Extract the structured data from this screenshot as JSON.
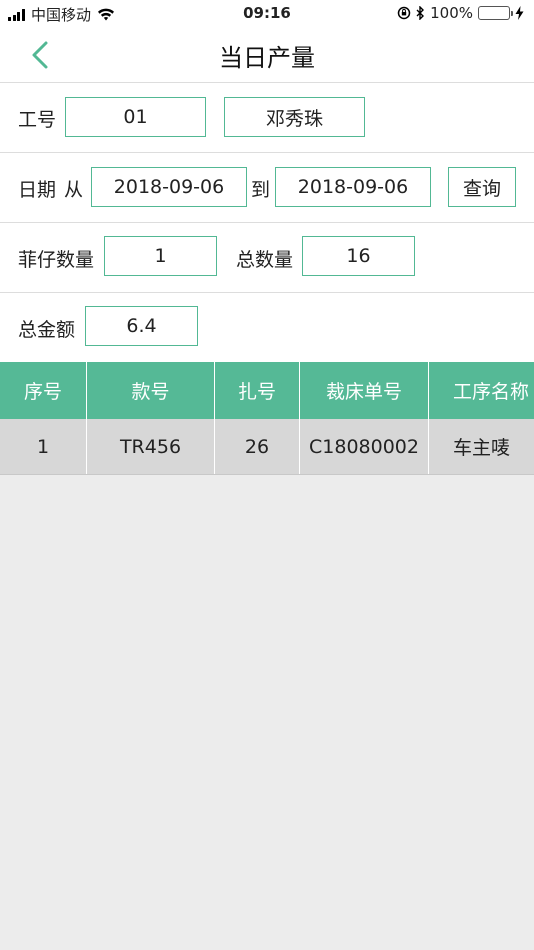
{
  "status_bar": {
    "carrier": "中国移动",
    "time": "09:16",
    "battery": "100%"
  },
  "nav": {
    "title": "当日产量"
  },
  "worker": {
    "id_label": "工号",
    "id_value": "01",
    "name_value": "邓秀珠"
  },
  "date": {
    "date_label": "日期",
    "from_label": "从",
    "from_value": "2018-09-06",
    "to_label": "到",
    "to_value": "2018-09-06",
    "query_label": "查询"
  },
  "counts": {
    "tickets_label": "菲仔数量",
    "tickets_value": "1",
    "total_label": "总数量",
    "total_value": "16"
  },
  "amount": {
    "label": "总金额",
    "value": "6.4"
  },
  "table": {
    "headers": [
      "序号",
      "款号",
      "扎号",
      "裁床单号",
      "工序名称"
    ],
    "rows": [
      [
        "1",
        "TR456",
        "26",
        "C18080002",
        "车主唛"
      ]
    ]
  },
  "colors": {
    "accent": "#55b996",
    "row_bg": "#d7d7d7",
    "page_bg": "#ececec"
  }
}
